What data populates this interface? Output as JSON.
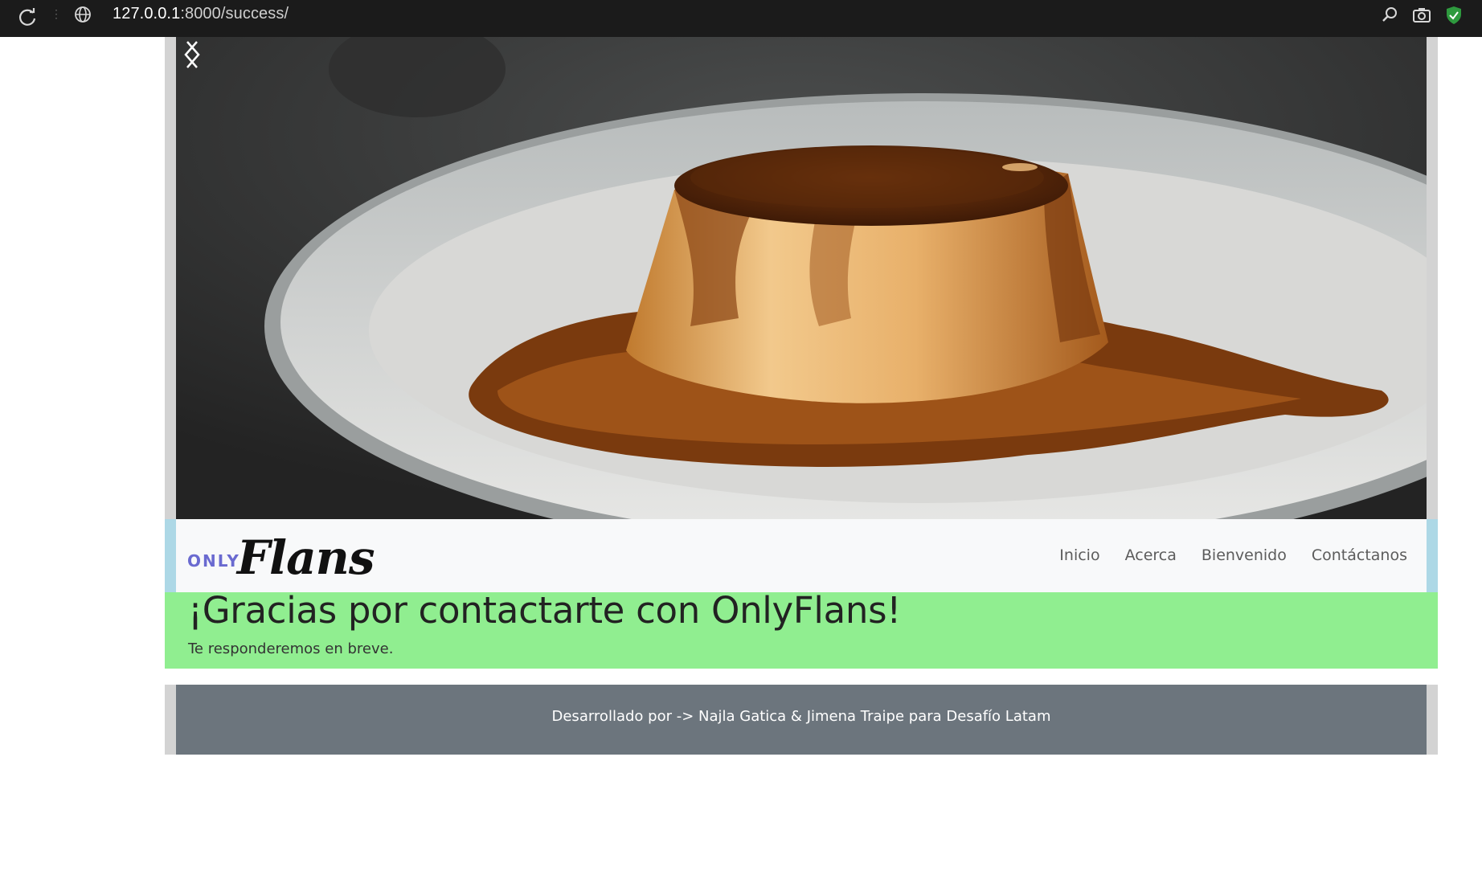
{
  "browser": {
    "url_host": "127.0.0.1",
    "url_rest": ":8000/success/"
  },
  "icons": {
    "reload": "reload-icon",
    "site_info": "globe-icon",
    "zoom": "zoom-icon",
    "screenshot": "camera-icon",
    "extension": "shield-icon"
  },
  "hero": {
    "image": "caramel-flan-on-plate",
    "prev": "chevron-left-icon",
    "next": "chevron-right-icon"
  },
  "brand": {
    "only": "ONLY",
    "flans": "Flans"
  },
  "nav": {
    "items": [
      "Inicio",
      "Acerca",
      "Bienvenido",
      "Contáctanos"
    ]
  },
  "success": {
    "title": "¡Gracias por contactarte con OnlyFlans!",
    "message": "Te responderemos en breve."
  },
  "footer": {
    "text": "Desarrollado por -> Najla Gatica & Jimena Traipe para Desafío Latam"
  },
  "colors": {
    "nav_accent": "#add8e6",
    "success_bg": "#90ee90",
    "footer_bg": "#6c757d",
    "side_gray": "#d3d3d3"
  }
}
